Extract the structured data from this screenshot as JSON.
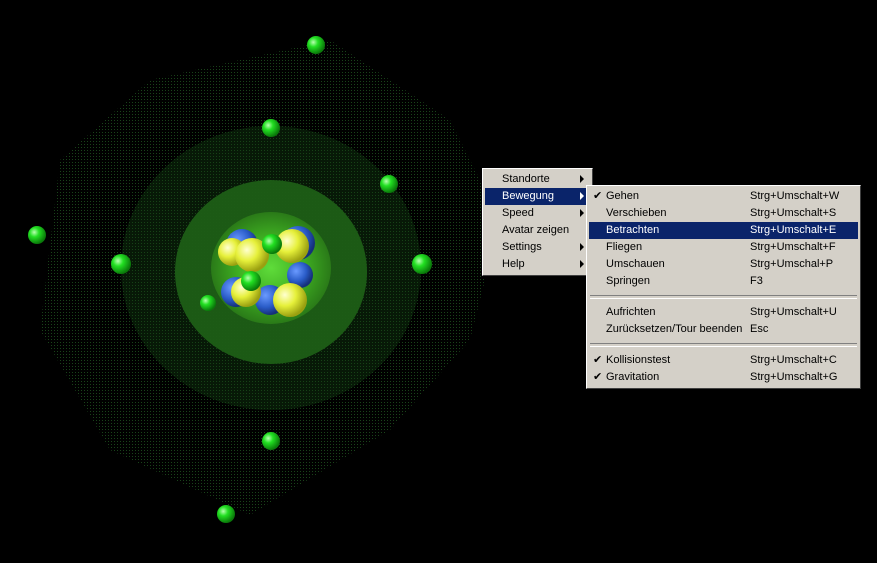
{
  "colors": {
    "menu_bg": "#d4d0c8",
    "highlight_bg": "#0a246a",
    "electron": "#20e020",
    "proton": "#e8f040",
    "neutron": "#3060c0"
  },
  "icons": {
    "checkmark": "check-icon",
    "submenu": "submenu-arrow-icon"
  },
  "context_menu": {
    "items": [
      {
        "label": "Standorte",
        "has_submenu": true
      },
      {
        "label": "Bewegung",
        "has_submenu": true,
        "highlighted": true
      },
      {
        "label": "Speed",
        "has_submenu": true
      },
      {
        "label": "Avatar zeigen",
        "has_submenu": false
      },
      {
        "label": "Settings",
        "has_submenu": true
      },
      {
        "label": "Help",
        "has_submenu": true
      }
    ]
  },
  "bewegung_submenu": {
    "check_glyph": "✔",
    "groups": [
      [
        {
          "label": "Gehen",
          "shortcut": "Strg+Umschalt+W",
          "checked": true
        },
        {
          "label": "Verschieben",
          "shortcut": "Strg+Umschalt+S"
        },
        {
          "label": "Betrachten",
          "shortcut": "Strg+Umschalt+E",
          "highlighted": true
        },
        {
          "label": "Fliegen",
          "shortcut": "Strg+Umschalt+F"
        },
        {
          "label": "Umschauen",
          "shortcut": "Strg+Umschal+P"
        },
        {
          "label": "Springen",
          "shortcut": "F3"
        }
      ],
      [
        {
          "label": "Aufrichten",
          "shortcut": "Strg+Umschalt+U"
        },
        {
          "label": "Zurücksetzen/Tour beenden",
          "shortcut": "Esc"
        }
      ],
      [
        {
          "label": "Kollisionstest",
          "shortcut": "Strg+Umschalt+C",
          "checked": true
        },
        {
          "label": "Gravitation",
          "shortcut": "Strg+Umschalt+G",
          "checked": true
        }
      ]
    ]
  }
}
